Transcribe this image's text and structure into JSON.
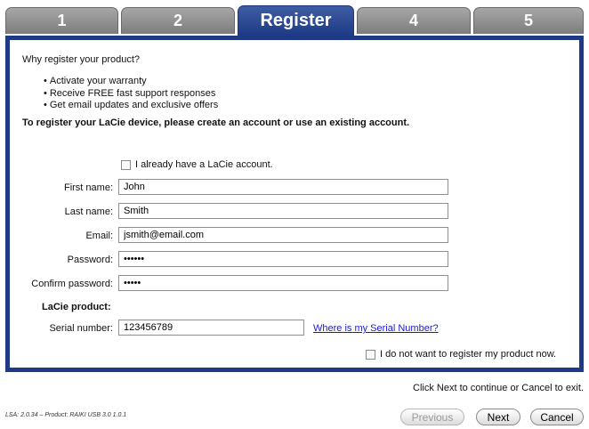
{
  "tabs": [
    {
      "label": "1"
    },
    {
      "label": "2"
    },
    {
      "label": "Register",
      "active": true
    },
    {
      "label": "4"
    },
    {
      "label": "5"
    }
  ],
  "colors": {
    "accent": "#1e3a86",
    "link": "#1a1ad6"
  },
  "panel": {
    "why_heading": "Why register your product?",
    "benefits": [
      "Activate your warranty",
      "Receive FREE fast support responses",
      "Get email updates and exclusive offers"
    ],
    "instruction": "To register your LaCie device, please create an account or use an existing account.",
    "existing_account_label": "I already have a LaCie account.",
    "existing_account_checked": false,
    "fields": {
      "first_name": {
        "label": "First name:",
        "value": "John"
      },
      "last_name": {
        "label": "Last name:",
        "value": "Smith"
      },
      "email": {
        "label": "Email:",
        "value": "jsmith@email.com"
      },
      "password": {
        "label": "Password:",
        "value": "••••••"
      },
      "confirm_password": {
        "label": "Confirm password:",
        "value": "•••••"
      }
    },
    "product_heading": "LaCie product:",
    "serial": {
      "label": "Serial number:",
      "value": "123456789"
    },
    "serial_help_link": "Where is my Serial Number?",
    "no_register_label": "I do not want to register my product now.",
    "no_register_checked": false
  },
  "footer": {
    "hint": "Click Next to continue or Cancel to exit.",
    "version": "LSA: 2.0.34 – Product: RAIKI USB 3.0 1.0.1",
    "previous_label": "Previous",
    "next_label": "Next",
    "cancel_label": "Cancel"
  }
}
